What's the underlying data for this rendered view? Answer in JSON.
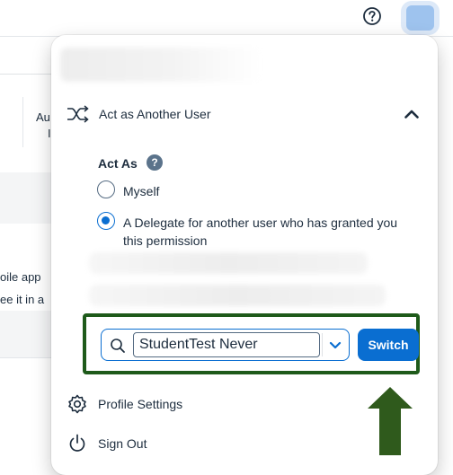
{
  "header": {
    "help_icon": "question-circle-icon",
    "avatar_color": "#9ec3ee"
  },
  "background_page": {
    "fragment_1": "Au",
    "fragment_2": "I",
    "fragment_3": "oile app",
    "fragment_4": "ee it in a"
  },
  "popover": {
    "section": {
      "title": "Act as Another User",
      "icon": "shuffle-icon",
      "expanded": true
    },
    "act_as": {
      "label": "Act As",
      "help_glyph": "?",
      "options": [
        {
          "label": "Myself",
          "selected": false
        },
        {
          "label": "A Delegate for another user who has granted you this permission",
          "selected": true
        }
      ]
    },
    "user_search": {
      "value": "StudentTest Never",
      "search_icon": "search-icon",
      "dropdown_icon": "chevron-down-icon"
    },
    "switch_label": "Switch",
    "menu": [
      {
        "label": "Profile Settings",
        "icon": "gear-icon"
      },
      {
        "label": "Sign Out",
        "icon": "power-icon"
      }
    ]
  },
  "annotation": {
    "highlight_color": "#1e5a1a",
    "arrow_color": "#2f5a1c"
  },
  "colors": {
    "accent": "#0a6ed1",
    "text": "#1d2d3e"
  }
}
